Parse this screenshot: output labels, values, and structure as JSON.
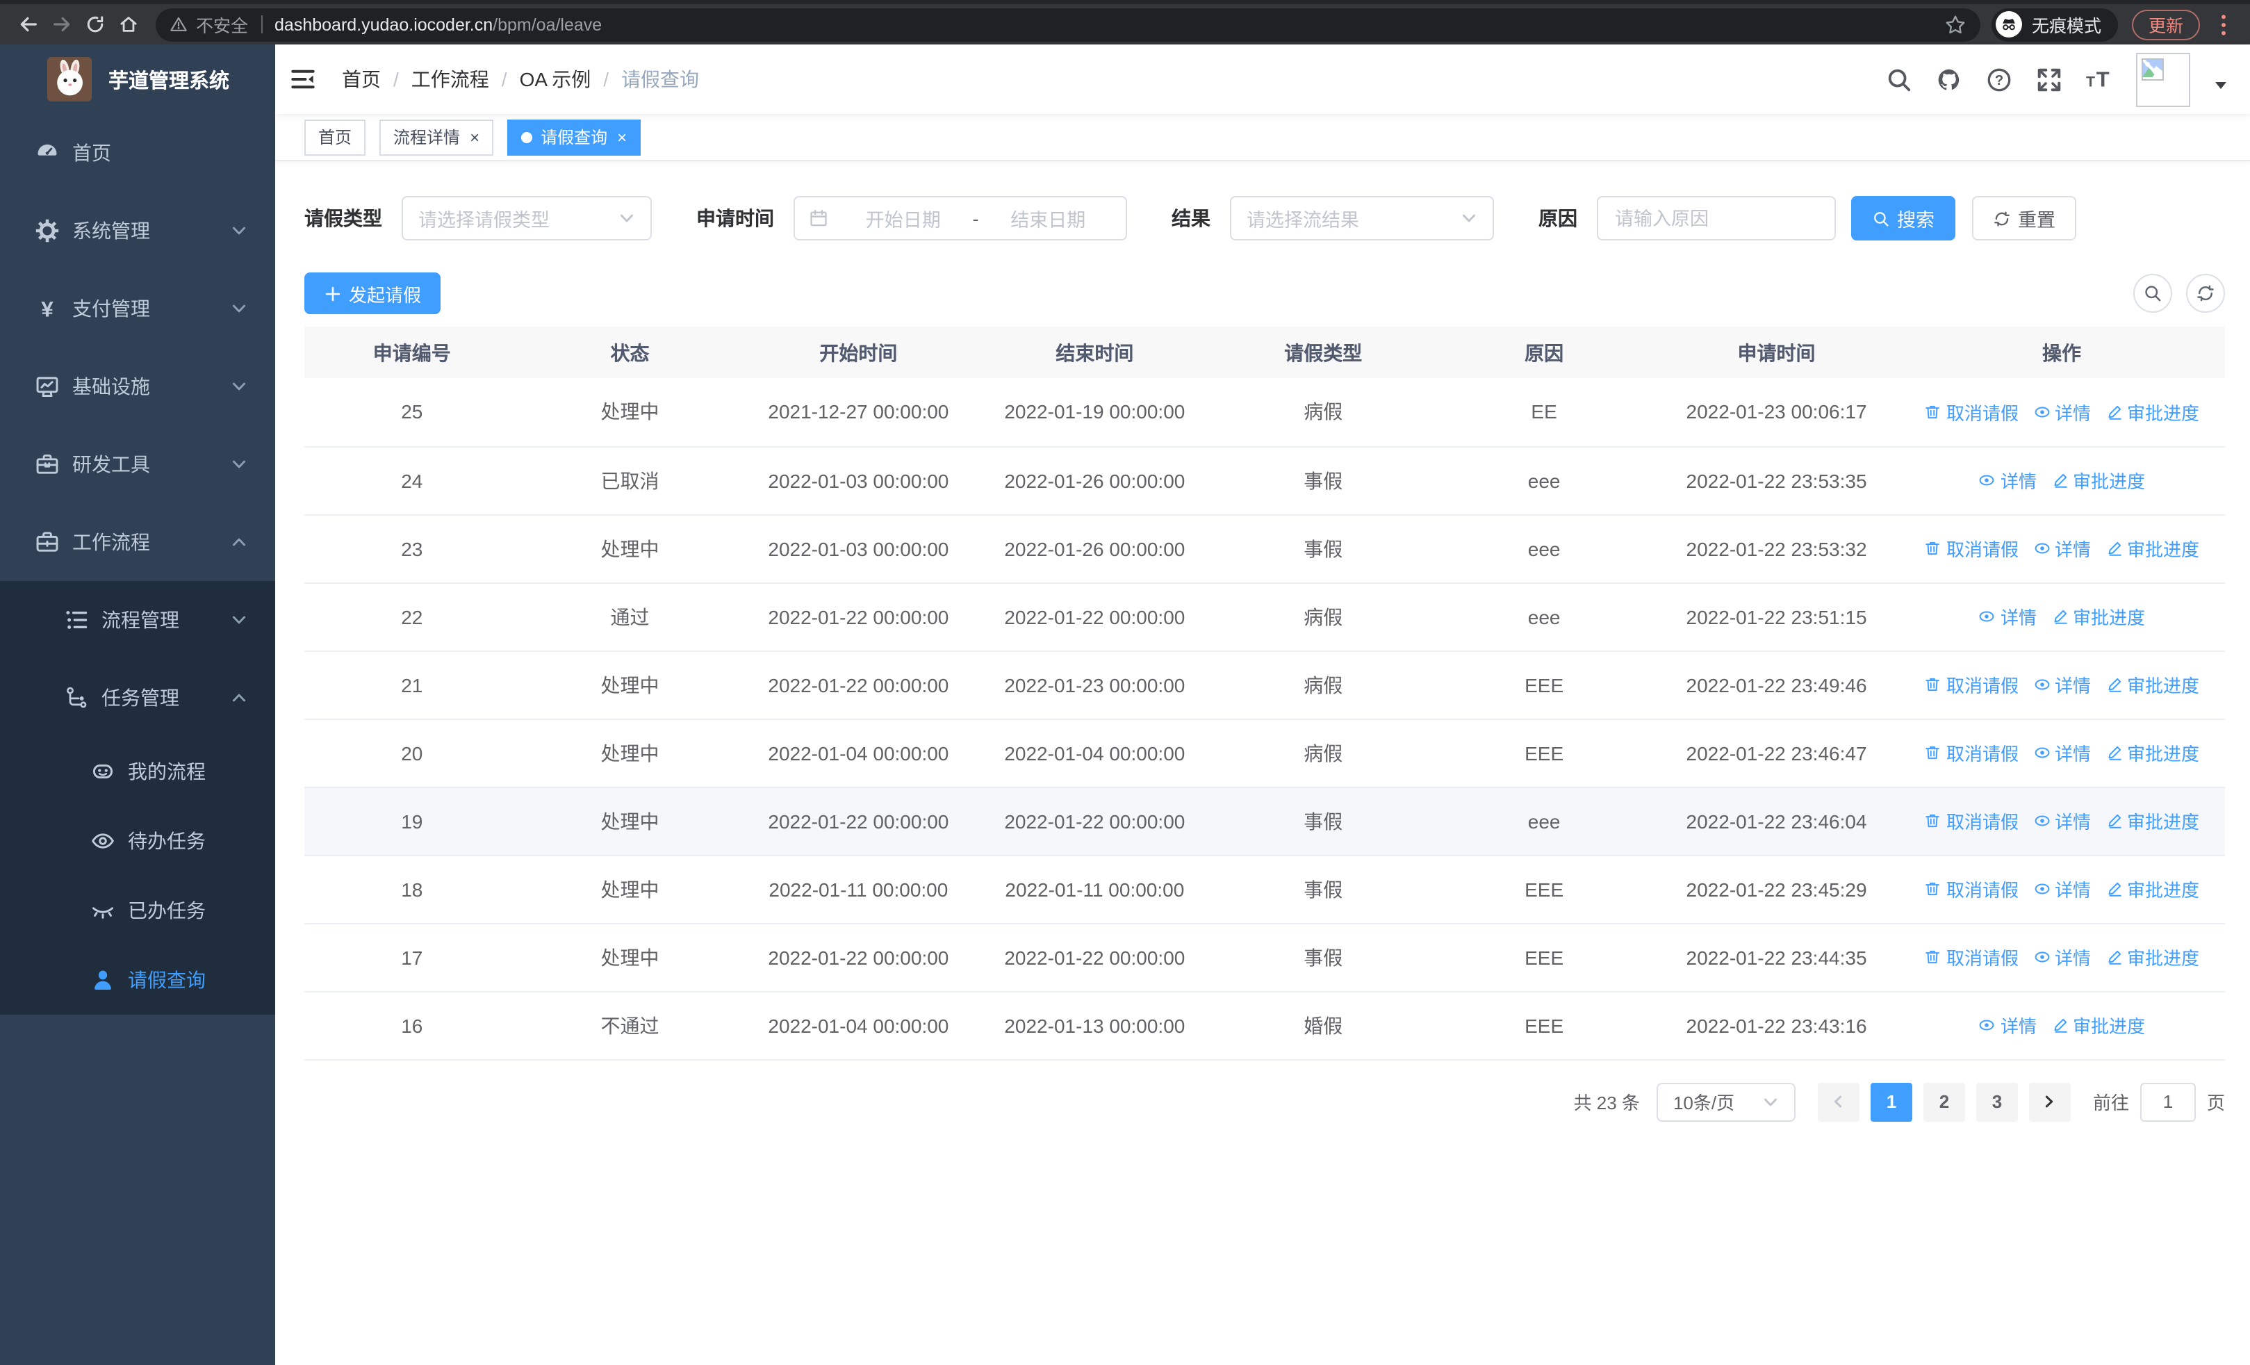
{
  "colors": {
    "accent": "#409eff",
    "sidebar_bg": "#304156",
    "submenu_bg": "#1f2d3d",
    "sidebar_text": "#bfcbd9",
    "chrome_update": "#f28b82"
  },
  "ui": {
    "close_glyph": "×"
  },
  "browser": {
    "security_label": "不安全",
    "url_host": "dashboard.yudao.iocoder.cn",
    "url_path": "/bpm/oa/leave",
    "incognito_label": "无痕模式",
    "update_label": "更新"
  },
  "sidebar": {
    "title": "芋道管理系统",
    "items": [
      {
        "label": "首页",
        "icon": "dashboard-icon",
        "level": 1
      },
      {
        "label": "系统管理",
        "icon": "gear-icon",
        "level": 1,
        "chevron": "down"
      },
      {
        "label": "支付管理",
        "icon": "yen-icon",
        "level": 1,
        "chevron": "down"
      },
      {
        "label": "基础设施",
        "icon": "monitor-icon",
        "level": 1,
        "chevron": "down"
      },
      {
        "label": "研发工具",
        "icon": "toolbox-icon",
        "level": 1,
        "chevron": "down"
      },
      {
        "label": "工作流程",
        "icon": "briefcase-icon",
        "level": 1,
        "chevron": "up"
      },
      {
        "label": "流程管理",
        "icon": "list-tree-icon",
        "level": 2,
        "chevron": "down",
        "dark": true
      },
      {
        "label": "任务管理",
        "icon": "flow-icon",
        "level": 2,
        "chevron": "up",
        "dark": true
      },
      {
        "label": "我的流程",
        "icon": "robot-icon",
        "level": 3,
        "dark": true
      },
      {
        "label": "待办任务",
        "icon": "eye-open-icon",
        "level": 3,
        "dark": true
      },
      {
        "label": "已办任务",
        "icon": "eye-closed-icon",
        "level": 3,
        "dark": true
      },
      {
        "label": "请假查询",
        "icon": "user-icon",
        "level": 3,
        "dark": true,
        "active": true
      }
    ]
  },
  "navbar": {
    "breadcrumb": [
      "首页",
      "工作流程",
      "OA 示例",
      "请假查询"
    ],
    "breadcrumb_separator": "/",
    "icons": [
      "search-icon",
      "github-icon",
      "help-icon",
      "fullscreen-icon",
      "font-size-icon"
    ]
  },
  "tags": [
    {
      "label": "首页",
      "closable": false,
      "active": false
    },
    {
      "label": "流程详情",
      "closable": true,
      "active": false
    },
    {
      "label": "请假查询",
      "closable": true,
      "active": true
    }
  ],
  "filters": {
    "leave_type_label": "请假类型",
    "leave_type_placeholder": "请选择请假类型",
    "apply_time_label": "申请时间",
    "start_date_placeholder": "开始日期",
    "range_separator": "-",
    "end_date_placeholder": "结束日期",
    "result_label": "结果",
    "result_placeholder": "请选择流结果",
    "reason_label": "原因",
    "reason_placeholder": "请输入原因",
    "search_label": "搜索",
    "reset_label": "重置"
  },
  "toolbar": {
    "create_label": "发起请假"
  },
  "table": {
    "columns": [
      "申请编号",
      "状态",
      "开始时间",
      "结束时间",
      "请假类型",
      "原因",
      "申请时间",
      "操作"
    ],
    "action_labels": {
      "cancel": "取消请假",
      "detail": "详情",
      "progress": "审批进度"
    },
    "rows": [
      {
        "id": "25",
        "status": "处理中",
        "start": "2021-12-27 00:00:00",
        "end": "2022-01-19 00:00:00",
        "type": "病假",
        "reason": "EE",
        "apply": "2022-01-23 00:06:17",
        "actions": [
          "cancel",
          "detail",
          "progress"
        ]
      },
      {
        "id": "24",
        "status": "已取消",
        "start": "2022-01-03 00:00:00",
        "end": "2022-01-26 00:00:00",
        "type": "事假",
        "reason": "eee",
        "apply": "2022-01-22 23:53:35",
        "actions": [
          "detail",
          "progress"
        ]
      },
      {
        "id": "23",
        "status": "处理中",
        "start": "2022-01-03 00:00:00",
        "end": "2022-01-26 00:00:00",
        "type": "事假",
        "reason": "eee",
        "apply": "2022-01-22 23:53:32",
        "actions": [
          "cancel",
          "detail",
          "progress"
        ]
      },
      {
        "id": "22",
        "status": "通过",
        "start": "2022-01-22 00:00:00",
        "end": "2022-01-22 00:00:00",
        "type": "病假",
        "reason": "eee",
        "apply": "2022-01-22 23:51:15",
        "actions": [
          "detail",
          "progress"
        ]
      },
      {
        "id": "21",
        "status": "处理中",
        "start": "2022-01-22 00:00:00",
        "end": "2022-01-23 00:00:00",
        "type": "病假",
        "reason": "EEE",
        "apply": "2022-01-22 23:49:46",
        "actions": [
          "cancel",
          "detail",
          "progress"
        ]
      },
      {
        "id": "20",
        "status": "处理中",
        "start": "2022-01-04 00:00:00",
        "end": "2022-01-04 00:00:00",
        "type": "病假",
        "reason": "EEE",
        "apply": "2022-01-22 23:46:47",
        "actions": [
          "cancel",
          "detail",
          "progress"
        ]
      },
      {
        "id": "19",
        "status": "处理中",
        "start": "2022-01-22 00:00:00",
        "end": "2022-01-22 00:00:00",
        "type": "事假",
        "reason": "eee",
        "apply": "2022-01-22 23:46:04",
        "actions": [
          "cancel",
          "detail",
          "progress"
        ],
        "highlight": true
      },
      {
        "id": "18",
        "status": "处理中",
        "start": "2022-01-11 00:00:00",
        "end": "2022-01-11 00:00:00",
        "type": "事假",
        "reason": "EEE",
        "apply": "2022-01-22 23:45:29",
        "actions": [
          "cancel",
          "detail",
          "progress"
        ]
      },
      {
        "id": "17",
        "status": "处理中",
        "start": "2022-01-22 00:00:00",
        "end": "2022-01-22 00:00:00",
        "type": "事假",
        "reason": "EEE",
        "apply": "2022-01-22 23:44:35",
        "actions": [
          "cancel",
          "detail",
          "progress"
        ]
      },
      {
        "id": "16",
        "status": "不通过",
        "start": "2022-01-04 00:00:00",
        "end": "2022-01-13 00:00:00",
        "type": "婚假",
        "reason": "EEE",
        "apply": "2022-01-22 23:43:16",
        "actions": [
          "detail",
          "progress"
        ]
      }
    ]
  },
  "pagination": {
    "total_label": "共 23 条",
    "page_size_label": "10条/页",
    "pages": [
      "1",
      "2",
      "3"
    ],
    "active_page": "1",
    "goto_label": "前往",
    "goto_value": "1",
    "page_unit_label": "页"
  }
}
